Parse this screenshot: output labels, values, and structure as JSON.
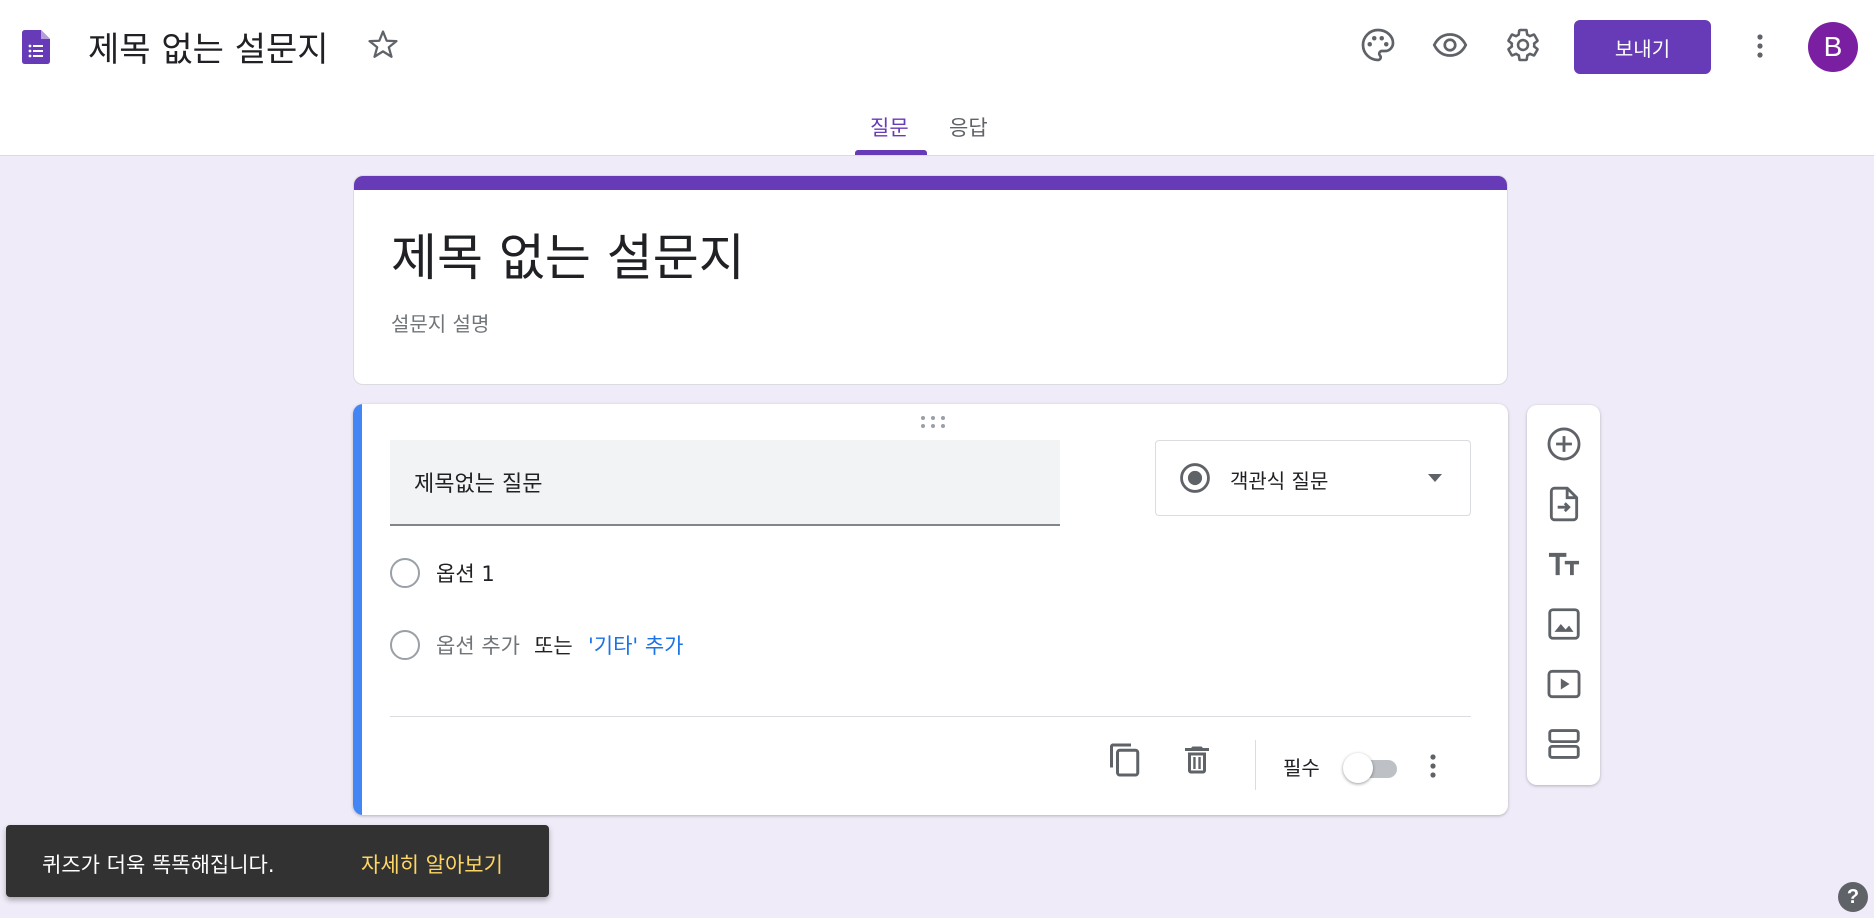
{
  "header": {
    "app_title": "제목 없는 설문지",
    "send_label": "보내기",
    "avatar_letter": "B",
    "tabs": [
      {
        "label": "질문",
        "active": true
      },
      {
        "label": "응답",
        "active": false
      }
    ],
    "icons": [
      "forms-doc-icon",
      "star-icon",
      "palette-icon",
      "eye-icon",
      "gear-icon",
      "more-vert-icon"
    ]
  },
  "form": {
    "title": "제목 없는 설문지",
    "description_placeholder": "설문지 설명"
  },
  "question": {
    "title": "제목없는 질문",
    "type_label": "객관식 질문",
    "options": [
      "옵션 1"
    ],
    "add_option": "옵션 추가",
    "or_text": "또는",
    "add_other": "'기타' 추가",
    "required_label": "필수",
    "required": false
  },
  "side_toolbar": [
    "add-question-icon",
    "import-questions-icon",
    "add-title-icon",
    "add-image-icon",
    "add-video-icon",
    "add-section-icon"
  ],
  "snackbar": {
    "message": "퀴즈가 더욱 똑똑해집니다.",
    "action": "자세히 알아보기"
  },
  "help": "?",
  "colors": {
    "accent": "#673ab7",
    "background": "#f0ebf8",
    "question_active_bar": "#4285f4",
    "link": "#1a73e8",
    "snack_action": "#fdd663"
  }
}
